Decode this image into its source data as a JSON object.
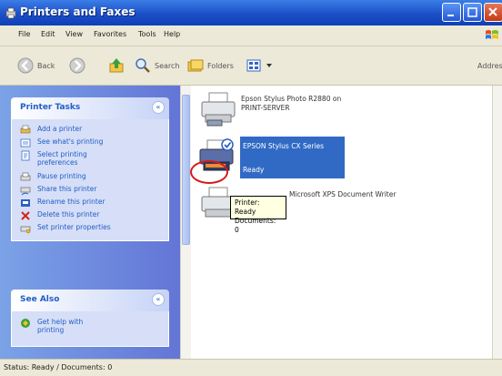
{
  "window": {
    "title": "Printers and Faxes"
  },
  "menubar": {
    "items": [
      "File",
      "Edit",
      "View",
      "Favorites",
      "Tools",
      "Help"
    ]
  },
  "toolbar": {
    "back_label": "Back",
    "search_label": "Search",
    "folders_label": "Folders",
    "address_label": "Address"
  },
  "tasks_panel": {
    "title": "Printer Tasks",
    "items": [
      {
        "label": "Add a printer",
        "icon": "add-printer-icon"
      },
      {
        "label": "See what's printing",
        "icon": "print-queue-icon"
      },
      {
        "label": "Select printing preferences",
        "icon": "preferences-icon"
      },
      {
        "label": "Pause printing",
        "icon": "pause-printer-icon"
      },
      {
        "label": "Share this printer",
        "icon": "share-printer-icon"
      },
      {
        "label": "Rename this printer",
        "icon": "rename-printer-icon"
      },
      {
        "label": "Delete this printer",
        "icon": "delete-icon"
      },
      {
        "label": "Set printer properties",
        "icon": "properties-icon"
      }
    ]
  },
  "see_also_panel": {
    "title": "See Also",
    "items": [
      {
        "label": "Get help with printing",
        "icon": "help-icon"
      }
    ]
  },
  "printers": [
    {
      "name": "Epson Stylus Photo R2880 on",
      "sub": "PRINT-SERVER"
    },
    {
      "name": "EPSON Stylus CX Series",
      "sub": "Ready",
      "selected": true
    },
    {
      "name": "Microsoft XPS Document Writer",
      "sub": ""
    }
  ],
  "tooltip": {
    "line1": "Printer: Ready",
    "line2": "Documents: 0"
  },
  "status": {
    "text": "Status: Ready / Documents: 0"
  }
}
